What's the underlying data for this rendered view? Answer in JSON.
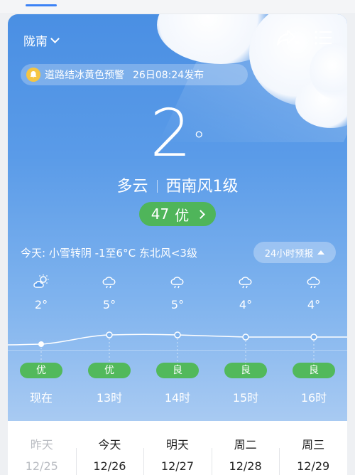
{
  "header": {
    "location": "陇南"
  },
  "alert": {
    "text": "道路结冰黄色预警",
    "time": "26日08:24发布"
  },
  "current": {
    "temperature": "2",
    "degree": "°",
    "condition": "多云",
    "wind": "西南风1级"
  },
  "aqi": {
    "value": "47",
    "level": "优",
    "color": "#4fb55a"
  },
  "today_summary": "今天: 小雪转阴  -1至6°C  东北风<3级",
  "forecast_button": "24小时预报",
  "hourly": [
    {
      "time": "现在",
      "temp": "2°",
      "icon": "partly-cloudy-icon",
      "aqi": "优"
    },
    {
      "time": "13时",
      "temp": "5°",
      "icon": "cloudy-icon",
      "aqi": "优"
    },
    {
      "time": "14时",
      "temp": "5°",
      "icon": "cloudy-icon",
      "aqi": "良"
    },
    {
      "time": "15时",
      "temp": "4°",
      "icon": "cloudy-icon",
      "aqi": "良"
    },
    {
      "time": "16时",
      "temp": "4°",
      "icon": "cloudy-icon",
      "aqi": "良"
    }
  ],
  "days": [
    {
      "name": "昨天",
      "date": "12/25"
    },
    {
      "name": "今天",
      "date": "12/26"
    },
    {
      "name": "明天",
      "date": "12/27"
    },
    {
      "name": "周二",
      "date": "12/28"
    },
    {
      "name": "周三",
      "date": "12/29"
    }
  ]
}
